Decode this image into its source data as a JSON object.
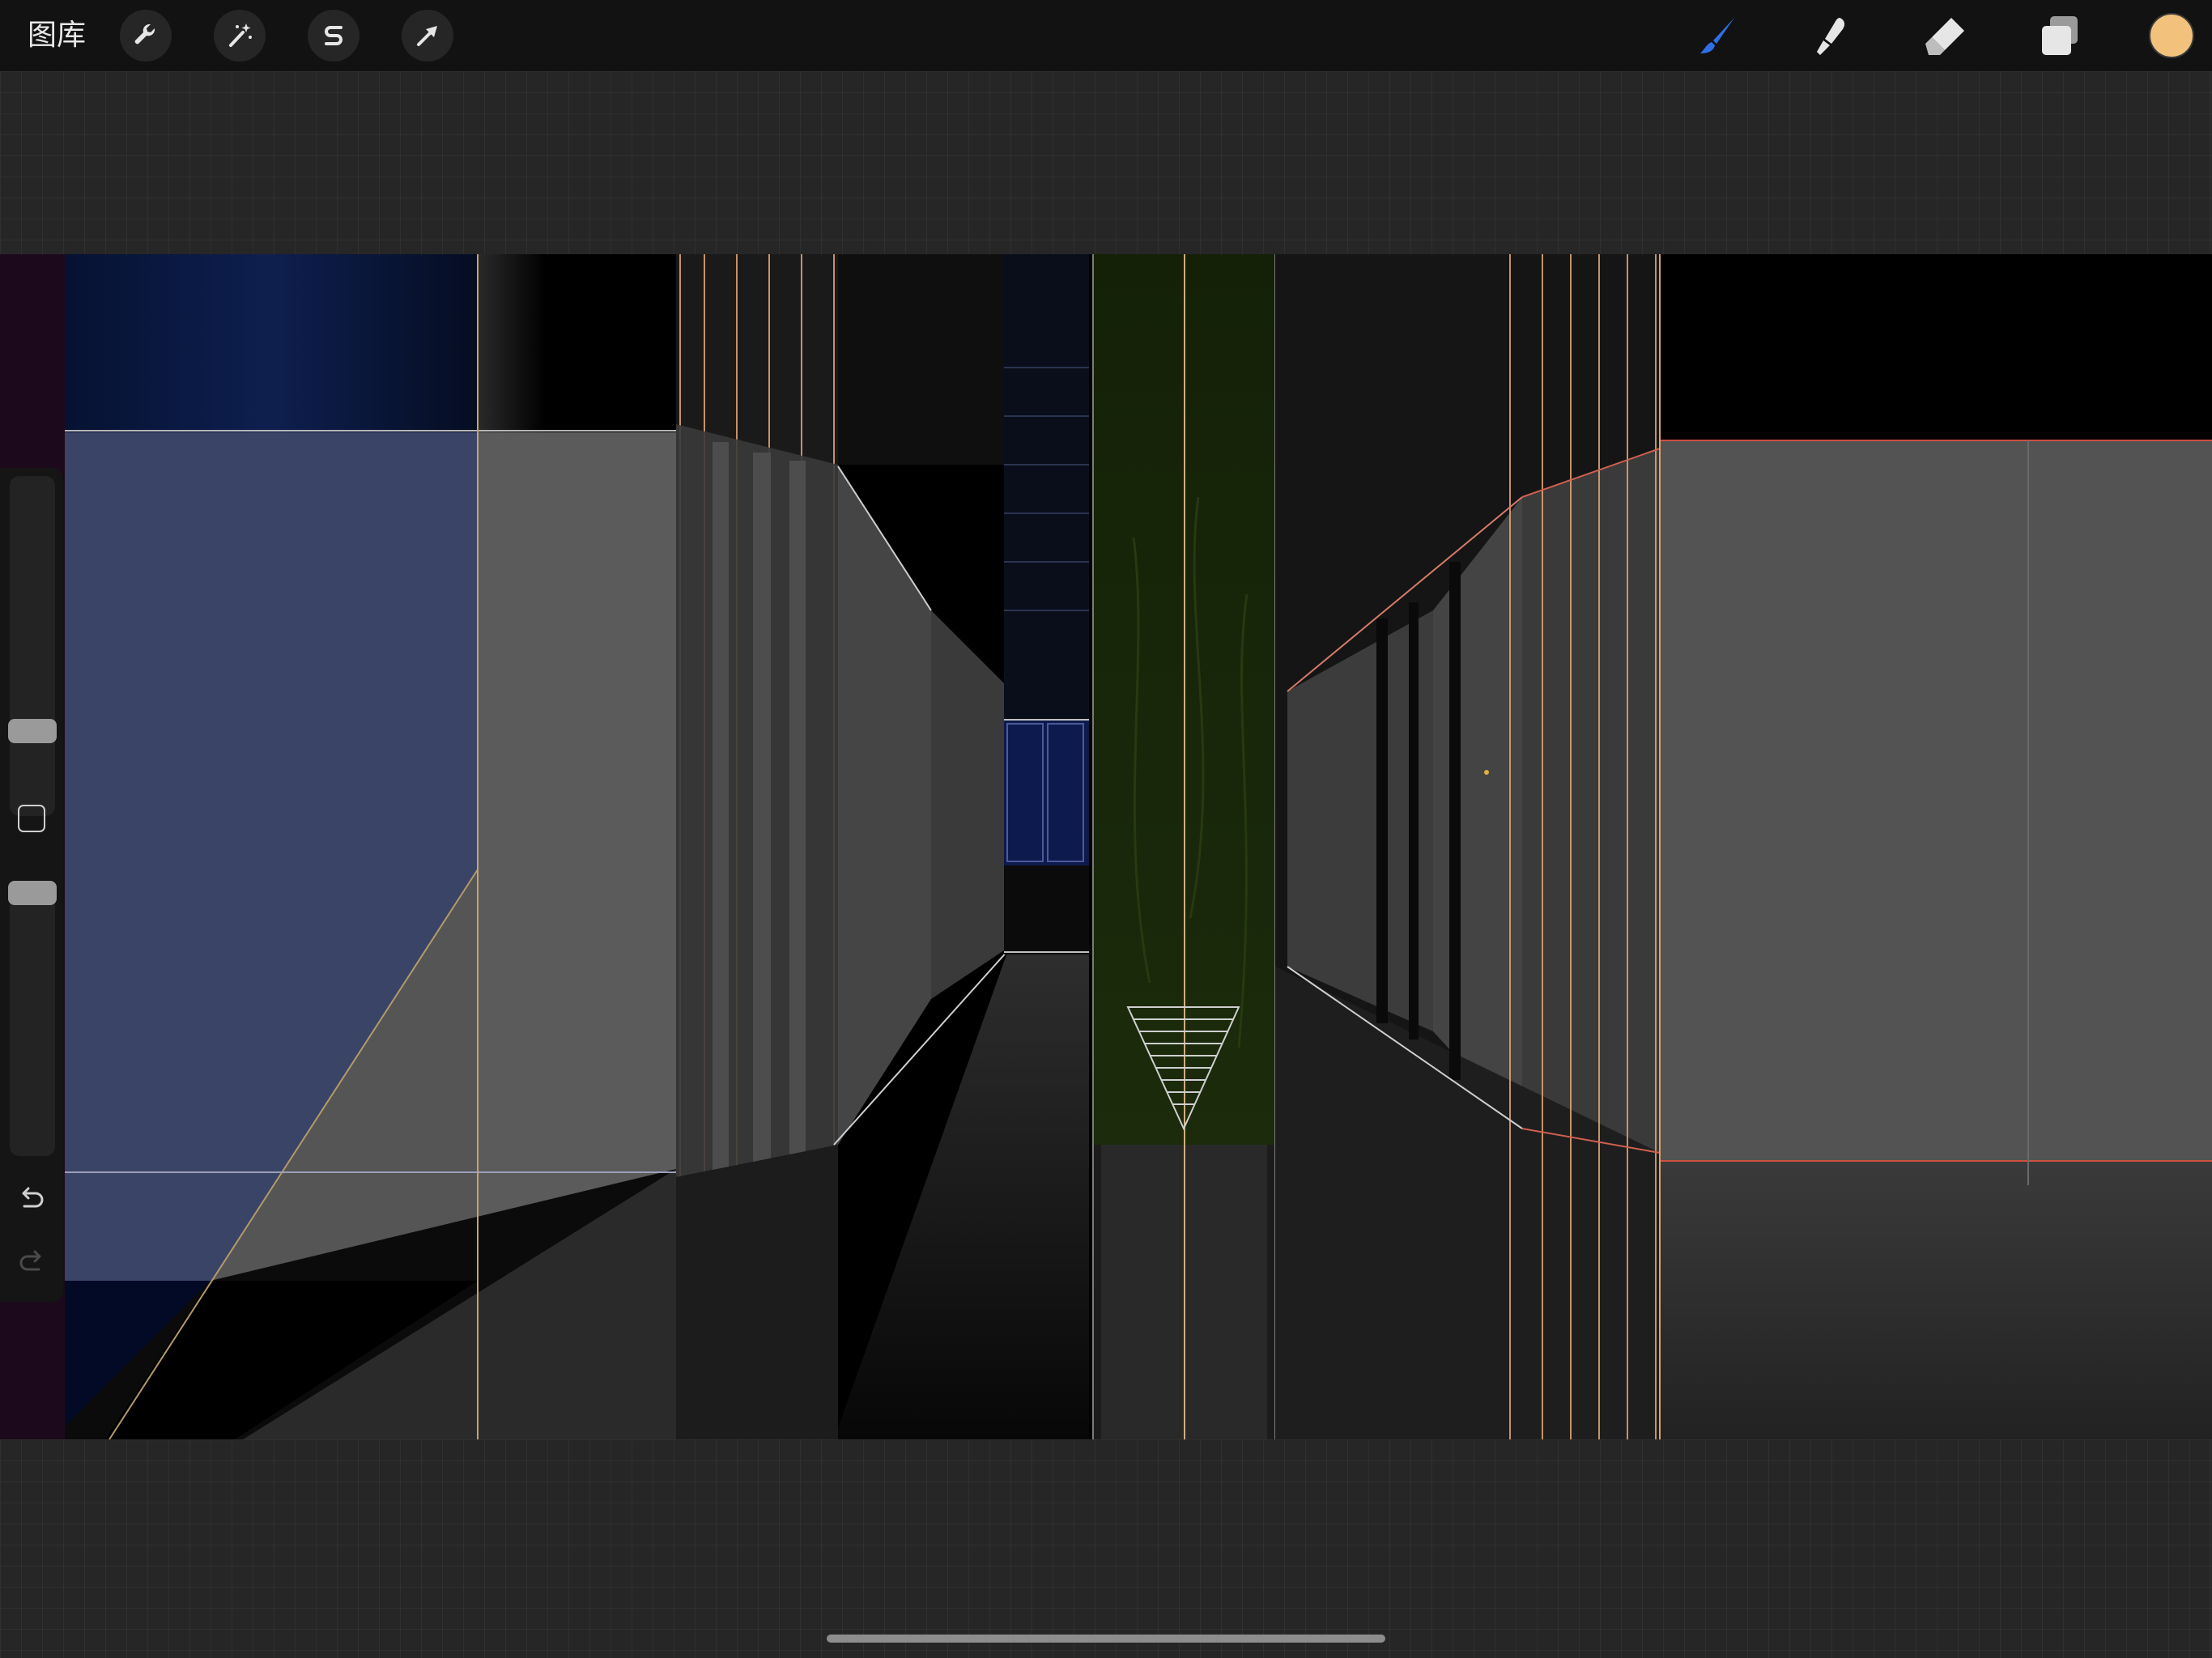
{
  "app": {
    "gallery_label": "图库",
    "color_swatch": "#F2C27D",
    "brush_icon_color": "#2F6FE6"
  },
  "toolbar_left": [
    {
      "icon": "wrench-icon",
      "name": "actions-button"
    },
    {
      "icon": "magic-wand-icon",
      "name": "adjustments-button"
    },
    {
      "icon": "selection-s-icon",
      "name": "selection-button"
    },
    {
      "icon": "arrow-cursor-icon",
      "name": "transform-button"
    }
  ],
  "toolbar_right": [
    {
      "icon": "brush-icon",
      "name": "paint-button"
    },
    {
      "icon": "smudge-icon",
      "name": "smudge-button"
    },
    {
      "icon": "eraser-icon",
      "name": "eraser-button"
    },
    {
      "icon": "layers-icon",
      "name": "layers-button"
    },
    {
      "icon": "color-swatch-icon",
      "name": "color-button"
    }
  ],
  "sidebar": {
    "brush_size_slider": "brush-size-slider",
    "opacity_slider": "opacity-slider",
    "modify_button": "modify-button",
    "undo_icon": "undo-icon",
    "redo_icon": "redo-icon"
  }
}
